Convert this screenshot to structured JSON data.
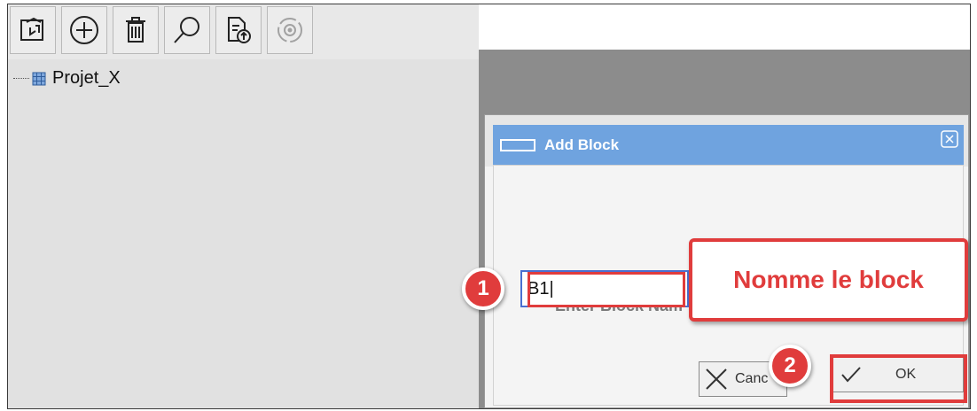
{
  "toolbar": {
    "buttons": [
      {
        "icon": "import-icon"
      },
      {
        "icon": "add-icon"
      },
      {
        "icon": "trash-icon"
      },
      {
        "icon": "search-icon"
      },
      {
        "icon": "export-file-icon"
      },
      {
        "icon": "settings-cycle-icon"
      }
    ]
  },
  "tree": {
    "root_label": "Projet_X"
  },
  "dialog": {
    "title": "Add Block",
    "field_label": "Enter Block Nam",
    "input_value": "B1|",
    "cancel_label": "Canc",
    "ok_label": "OK"
  },
  "annotations": {
    "callout_text": "Nomme le block",
    "step1": "1",
    "step2": "2",
    "color": "#e03c3c"
  },
  "colors": {
    "titlebar": "#6fa3df",
    "panel": "#e1e1e1",
    "backdrop": "#8c8c8c"
  }
}
